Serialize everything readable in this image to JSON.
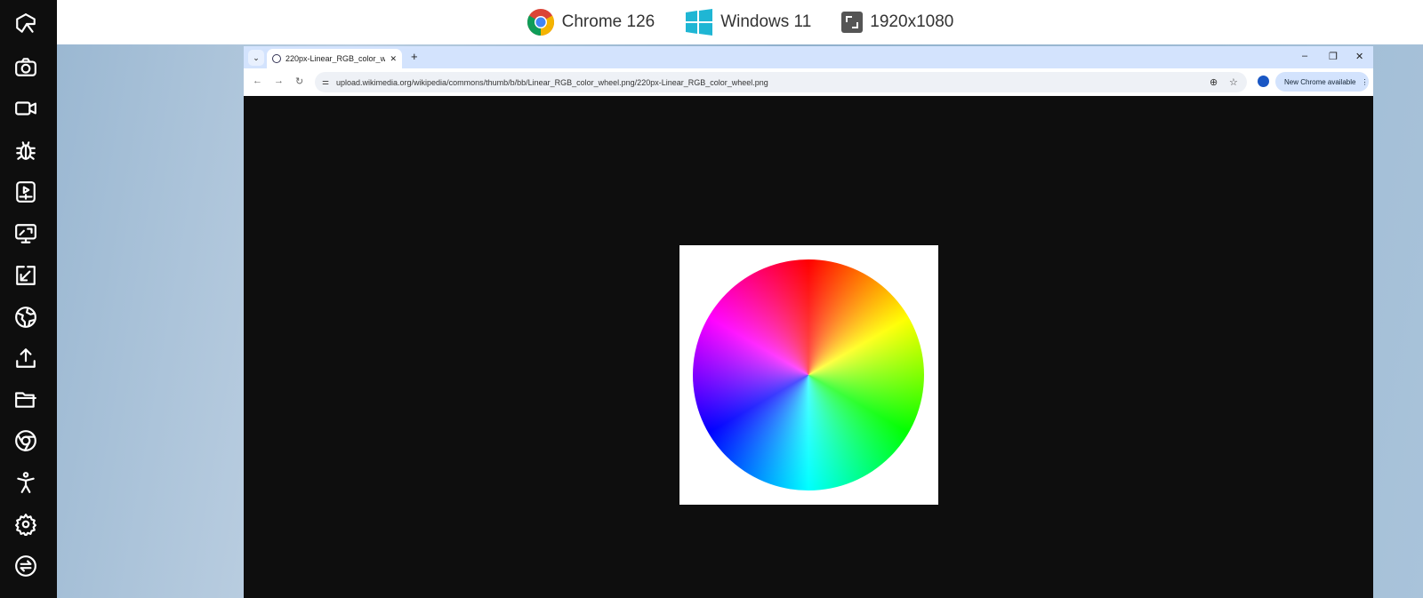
{
  "topbar": {
    "browser": "Chrome 126",
    "os": "Windows 11",
    "resolution": "1920x1080"
  },
  "sidebar": {
    "icons": [
      "logo-icon",
      "camera-icon",
      "video-icon",
      "bug-icon",
      "media-player-icon",
      "screen-resize-icon",
      "arrow-diagonal-icon",
      "globe-icon",
      "upload-icon",
      "folder-icon",
      "chrome-icon",
      "accessibility-icon",
      "gear-icon",
      "switch-icon"
    ]
  },
  "browser": {
    "tab_title": "220px-Linear_RGB_color_wheel.png",
    "url": "upload.wikimedia.org/wikipedia/commons/thumb/b/bb/Linear_RGB_color_wheel.png/220px-Linear_RGB_color_wheel.png",
    "new_chrome": "New Chrome available",
    "colors": {
      "tabstrip": "#d3e3fd",
      "content_bg": "#0e0e0e"
    }
  }
}
